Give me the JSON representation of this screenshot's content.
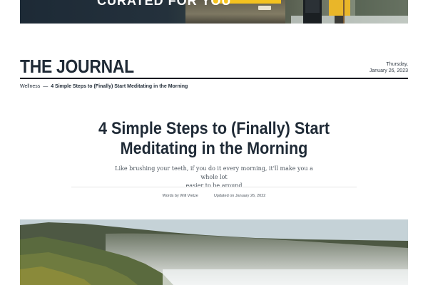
{
  "banner": {
    "text": "CURATED FOR YOU"
  },
  "journal": {
    "title": "THE JOURNAL",
    "date_weekday": "Thursday,",
    "date_full": "January 26, 2023"
  },
  "breadcrumb": {
    "category": "Wellness",
    "separator": "—",
    "current": "4 Simple Steps to (Finally) Start Meditating in the Morning"
  },
  "article": {
    "title_line1": "4 Simple Steps to (Finally) Start",
    "title_line2": "Meditating in the Morning",
    "deck_line1": "Like brushing your teeth, if you do it every morning, it'll make you a whole lot",
    "deck_line2": "easier to be around",
    "byline": "Words by Will Vietze",
    "updated": "Updated on January 26, 2022"
  },
  "colors": {
    "navy": "#1f2a36",
    "accent_yellow": "#f4c21f"
  },
  "icons": {
    "hero": "misty-forest-photo",
    "banner": "van-camping-photo"
  }
}
